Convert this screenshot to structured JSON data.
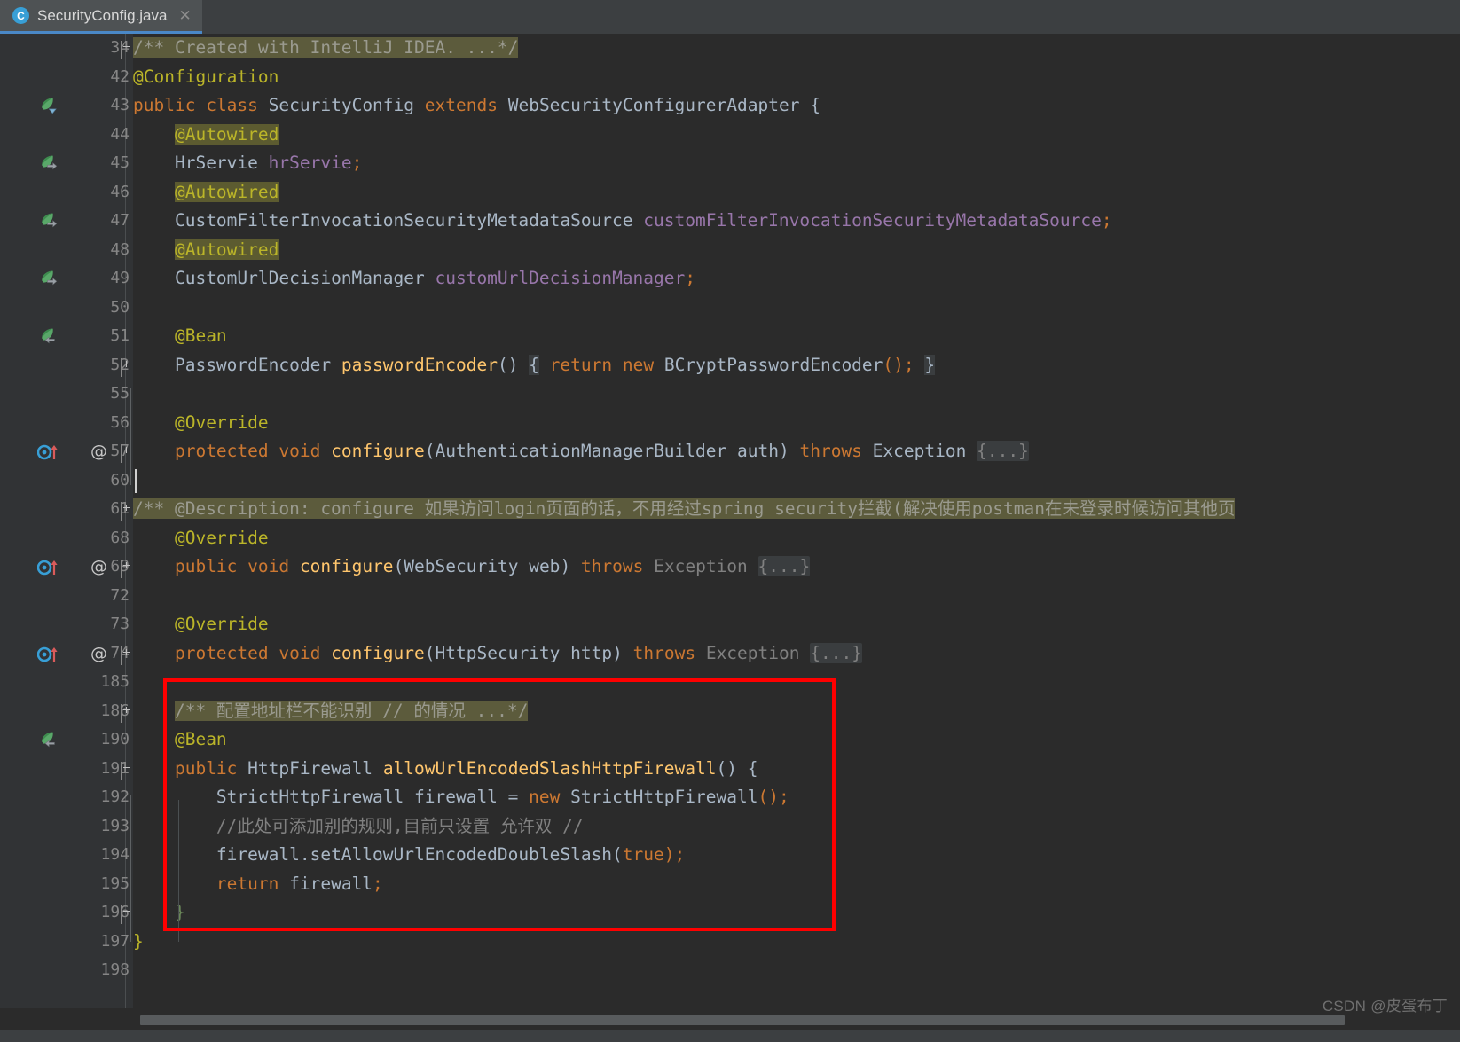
{
  "window": {
    "app": "IntelliJ IDEA",
    "theme": "Darcula"
  },
  "tabbar": {
    "tabs": [
      {
        "label": "SecurityConfig.java",
        "icon": "java-class-icon",
        "icon_letter": "C",
        "close_glyph": "✕",
        "active": true
      }
    ]
  },
  "editor": {
    "language": "Java",
    "caret": {
      "line": 60,
      "column": 1
    },
    "colors": {
      "background": "#2b2b2b",
      "gutter_background": "#313335",
      "keyword": "#cc7832",
      "identifier": "#a9b7c6",
      "field": "#9876aa",
      "method": "#ffc66d",
      "annotation": "#bbb529",
      "comment": "#808080",
      "number": "#6897bb",
      "folded_background": "#3a3d3f",
      "doc_fold_background": "#5c5b3c",
      "annotation_highlight": "#5c5b30",
      "tab_underline": "#4a88c7",
      "callout_red": "#ff0000"
    },
    "lines": [
      {
        "number": "34",
        "gutter": [
          "fold-collapse-top"
        ],
        "segments": [
          {
            "text": "/** Created with IntelliJ IDEA. ...*/",
            "cls": "doc-fold"
          }
        ]
      },
      {
        "number": "42",
        "gutter": [],
        "segments": [
          {
            "text": "@Configuration",
            "cls": "anno"
          }
        ]
      },
      {
        "number": "43",
        "gutter": [
          "spring-bean-icon-dropdown"
        ],
        "segments": [
          {
            "text": "public",
            "cls": "kw"
          },
          {
            "text": " ",
            "cls": "plain"
          },
          {
            "text": "class",
            "cls": "kw"
          },
          {
            "text": " ",
            "cls": "plain"
          },
          {
            "text": "SecurityConfig",
            "cls": "cls"
          },
          {
            "text": " ",
            "cls": "plain"
          },
          {
            "text": "extends",
            "cls": "kw"
          },
          {
            "text": " ",
            "cls": "plain"
          },
          {
            "text": "WebSecurityConfigurerAdapter",
            "cls": "cls"
          },
          {
            "text": " {",
            "cls": "plain"
          }
        ]
      },
      {
        "number": "44",
        "gutter": [],
        "segments": [
          {
            "text": "    ",
            "cls": "plain"
          },
          {
            "text": "@Autowired",
            "cls": "anno-hl"
          }
        ]
      },
      {
        "number": "45",
        "gutter": [
          "spring-bean-icon-arrow"
        ],
        "segments": [
          {
            "text": "    ",
            "cls": "plain"
          },
          {
            "text": "HrServie",
            "cls": "cls"
          },
          {
            "text": " ",
            "cls": "plain"
          },
          {
            "text": "hrServie",
            "cls": "fld"
          },
          {
            "text": ";",
            "cls": "kw"
          }
        ]
      },
      {
        "number": "46",
        "gutter": [],
        "segments": [
          {
            "text": "    ",
            "cls": "plain"
          },
          {
            "text": "@Autowired",
            "cls": "anno-hl"
          }
        ]
      },
      {
        "number": "47",
        "gutter": [
          "spring-bean-icon-arrow"
        ],
        "segments": [
          {
            "text": "    ",
            "cls": "plain"
          },
          {
            "text": "CustomFilterInvocationSecurityMetadataSource",
            "cls": "cls"
          },
          {
            "text": " ",
            "cls": "plain"
          },
          {
            "text": "customFilterInvocationSecurityMetadataSource",
            "cls": "fld"
          },
          {
            "text": ";",
            "cls": "kw"
          }
        ]
      },
      {
        "number": "48",
        "gutter": [],
        "segments": [
          {
            "text": "    ",
            "cls": "plain"
          },
          {
            "text": "@Autowired",
            "cls": "anno-hl"
          }
        ]
      },
      {
        "number": "49",
        "gutter": [
          "spring-bean-icon-arrow"
        ],
        "segments": [
          {
            "text": "    ",
            "cls": "plain"
          },
          {
            "text": "CustomUrlDecisionManager",
            "cls": "cls"
          },
          {
            "text": " ",
            "cls": "plain"
          },
          {
            "text": "customUrlDecisionManager",
            "cls": "fld"
          },
          {
            "text": ";",
            "cls": "kw"
          }
        ]
      },
      {
        "number": "50",
        "gutter": [],
        "segments": []
      },
      {
        "number": "51",
        "gutter": [
          "spring-bean-icon-back"
        ],
        "segments": [
          {
            "text": "    ",
            "cls": "plain"
          },
          {
            "text": "@Bean",
            "cls": "anno"
          }
        ]
      },
      {
        "number": "52",
        "gutter": [
          "fold-plus"
        ],
        "segments": [
          {
            "text": "    ",
            "cls": "plain"
          },
          {
            "text": "PasswordEncoder",
            "cls": "cls"
          },
          {
            "text": " ",
            "cls": "plain"
          },
          {
            "text": "passwordEncoder",
            "cls": "mth"
          },
          {
            "text": "() ",
            "cls": "plain"
          },
          {
            "text": "{",
            "cls": "fold-brace"
          },
          {
            "text": " ",
            "cls": "plain"
          },
          {
            "text": "return",
            "cls": "kw"
          },
          {
            "text": " ",
            "cls": "plain"
          },
          {
            "text": "new",
            "cls": "kw"
          },
          {
            "text": " ",
            "cls": "plain"
          },
          {
            "text": "BCryptPasswordEncoder",
            "cls": "cls"
          },
          {
            "text": "();",
            "cls": "kw"
          },
          {
            "text": " ",
            "cls": "plain"
          },
          {
            "text": "}",
            "cls": "fold-brace"
          }
        ]
      },
      {
        "number": "55",
        "gutter": [],
        "segments": []
      },
      {
        "number": "56",
        "gutter": [],
        "segments": [
          {
            "text": "    ",
            "cls": "plain"
          },
          {
            "text": "@Override",
            "cls": "anno"
          }
        ]
      },
      {
        "number": "57",
        "gutter": [
          "override-method-icon",
          "at-sign",
          "fold-plus"
        ],
        "segments": [
          {
            "text": "    ",
            "cls": "plain"
          },
          {
            "text": "protected",
            "cls": "kw"
          },
          {
            "text": " ",
            "cls": "plain"
          },
          {
            "text": "void",
            "cls": "kw"
          },
          {
            "text": " ",
            "cls": "plain"
          },
          {
            "text": "configure",
            "cls": "mth"
          },
          {
            "text": "(",
            "cls": "plain"
          },
          {
            "text": "AuthenticationManagerBuilder",
            "cls": "cls"
          },
          {
            "text": " ",
            "cls": "plain"
          },
          {
            "text": "auth",
            "cls": "plain"
          },
          {
            "text": ") ",
            "cls": "plain"
          },
          {
            "text": "throws",
            "cls": "kw"
          },
          {
            "text": " ",
            "cls": "plain"
          },
          {
            "text": "Exception",
            "cls": "cls"
          },
          {
            "text": " ",
            "cls": "plain"
          },
          {
            "text": "{...}",
            "cls": "fold"
          }
        ]
      },
      {
        "number": "60",
        "gutter": [],
        "caret": true,
        "segments": []
      },
      {
        "number": "61",
        "gutter": [
          "fold-plus"
        ],
        "segments": [
          {
            "text": "/** @Description: configure 如果访问login页面的话，不用经过spring security拦截(解决使用postman在未登录时候访问其他页",
            "cls": "doc-fold"
          }
        ]
      },
      {
        "number": "68",
        "gutter": [],
        "segments": [
          {
            "text": "    ",
            "cls": "plain"
          },
          {
            "text": "@Override",
            "cls": "anno"
          }
        ]
      },
      {
        "number": "69",
        "gutter": [
          "override-method-icon",
          "at-sign",
          "fold-plus"
        ],
        "segments": [
          {
            "text": "    ",
            "cls": "plain"
          },
          {
            "text": "public",
            "cls": "kw"
          },
          {
            "text": " ",
            "cls": "plain"
          },
          {
            "text": "void",
            "cls": "kw"
          },
          {
            "text": " ",
            "cls": "plain"
          },
          {
            "text": "configure",
            "cls": "mth"
          },
          {
            "text": "(",
            "cls": "plain"
          },
          {
            "text": "WebSecurity",
            "cls": "cls"
          },
          {
            "text": " ",
            "cls": "plain"
          },
          {
            "text": "web",
            "cls": "plain"
          },
          {
            "text": ") ",
            "cls": "plain"
          },
          {
            "text": "throws",
            "cls": "kw"
          },
          {
            "text": " ",
            "cls": "plain"
          },
          {
            "text": "Exception",
            "cls": "grey"
          },
          {
            "text": " ",
            "cls": "plain"
          },
          {
            "text": "{...}",
            "cls": "fold"
          }
        ]
      },
      {
        "number": "72",
        "gutter": [],
        "segments": []
      },
      {
        "number": "73",
        "gutter": [],
        "segments": [
          {
            "text": "    ",
            "cls": "plain"
          },
          {
            "text": "@Override",
            "cls": "anno"
          }
        ]
      },
      {
        "number": "74",
        "gutter": [
          "override-method-icon",
          "at-sign",
          "fold-plus"
        ],
        "segments": [
          {
            "text": "    ",
            "cls": "plain"
          },
          {
            "text": "protected",
            "cls": "kw"
          },
          {
            "text": " ",
            "cls": "plain"
          },
          {
            "text": "void",
            "cls": "kw"
          },
          {
            "text": " ",
            "cls": "plain"
          },
          {
            "text": "configure",
            "cls": "mth"
          },
          {
            "text": "(",
            "cls": "plain"
          },
          {
            "text": "HttpSecurity",
            "cls": "cls"
          },
          {
            "text": " ",
            "cls": "plain"
          },
          {
            "text": "http",
            "cls": "plain"
          },
          {
            "text": ") ",
            "cls": "plain"
          },
          {
            "text": "throws",
            "cls": "kw"
          },
          {
            "text": " ",
            "cls": "plain"
          },
          {
            "text": "Exception",
            "cls": "grey"
          },
          {
            "text": " ",
            "cls": "plain"
          },
          {
            "text": "{...}",
            "cls": "fold"
          }
        ]
      },
      {
        "number": "185",
        "gutter": [],
        "segments": []
      },
      {
        "number": "186",
        "gutter": [
          "fold-plus"
        ],
        "segments": [
          {
            "text": "    ",
            "cls": "plain"
          },
          {
            "text": "/** 配置地址栏不能识别 // 的情况 ...*/",
            "cls": "doc-fold"
          }
        ]
      },
      {
        "number": "190",
        "gutter": [
          "spring-bean-icon-back"
        ],
        "segments": [
          {
            "text": "    ",
            "cls": "plain"
          },
          {
            "text": "@Bean",
            "cls": "anno"
          }
        ]
      },
      {
        "number": "191",
        "gutter": [
          "fold-collapse-top"
        ],
        "segments": [
          {
            "text": "    ",
            "cls": "plain"
          },
          {
            "text": "public",
            "cls": "kw"
          },
          {
            "text": " ",
            "cls": "plain"
          },
          {
            "text": "HttpFirewall",
            "cls": "cls"
          },
          {
            "text": " ",
            "cls": "plain"
          },
          {
            "text": "allowUrlEncodedSlashHttpFirewall",
            "cls": "mth"
          },
          {
            "text": "() {",
            "cls": "plain"
          }
        ]
      },
      {
        "number": "192",
        "gutter": [],
        "segments": [
          {
            "text": "        ",
            "cls": "plain"
          },
          {
            "text": "StrictHttpFirewall",
            "cls": "cls"
          },
          {
            "text": " ",
            "cls": "plain"
          },
          {
            "text": "firewall",
            "cls": "plain"
          },
          {
            "text": " = ",
            "cls": "plain"
          },
          {
            "text": "new",
            "cls": "kw"
          },
          {
            "text": " ",
            "cls": "plain"
          },
          {
            "text": "StrictHttpFirewall",
            "cls": "cls"
          },
          {
            "text": "();",
            "cls": "kw"
          }
        ]
      },
      {
        "number": "193",
        "gutter": [],
        "segments": [
          {
            "text": "        ",
            "cls": "plain"
          },
          {
            "text": "//此处可添加别的规则,目前只设置 允许双 //",
            "cls": "cmt"
          }
        ]
      },
      {
        "number": "194",
        "gutter": [],
        "segments": [
          {
            "text": "        ",
            "cls": "plain"
          },
          {
            "text": "firewall",
            "cls": "plain"
          },
          {
            "text": ".setAllowUrlEncodedDoubleSlash",
            "cls": "plain"
          },
          {
            "text": "(",
            "cls": "plain"
          },
          {
            "text": "true",
            "cls": "kw"
          },
          {
            "text": ");",
            "cls": "kw"
          }
        ]
      },
      {
        "number": "195",
        "gutter": [],
        "segments": [
          {
            "text": "        ",
            "cls": "plain"
          },
          {
            "text": "return",
            "cls": "kw"
          },
          {
            "text": " ",
            "cls": "plain"
          },
          {
            "text": "firewall",
            "cls": "plain"
          },
          {
            "text": ";",
            "cls": "kw"
          }
        ]
      },
      {
        "number": "196",
        "gutter": [
          "fold-collapse-bottom"
        ],
        "segments": [
          {
            "text": "    ",
            "cls": "plain"
          },
          {
            "text": "}",
            "cls": "str"
          }
        ]
      },
      {
        "number": "197",
        "gutter": [],
        "segments": [
          {
            "text": "}",
            "cls": "anno"
          }
        ]
      },
      {
        "number": "198",
        "gutter": [],
        "segments": []
      }
    ]
  },
  "callout": {
    "shape": "rectangle",
    "color": "#ff0000",
    "covers_lines": [
      "186",
      "190",
      "191",
      "192",
      "193",
      "194",
      "195",
      "196"
    ]
  },
  "scrollbar": {
    "orientation": "horizontal",
    "name": "horizontal-scrollbar"
  },
  "watermark": {
    "text": "CSDN @皮蛋布丁"
  }
}
